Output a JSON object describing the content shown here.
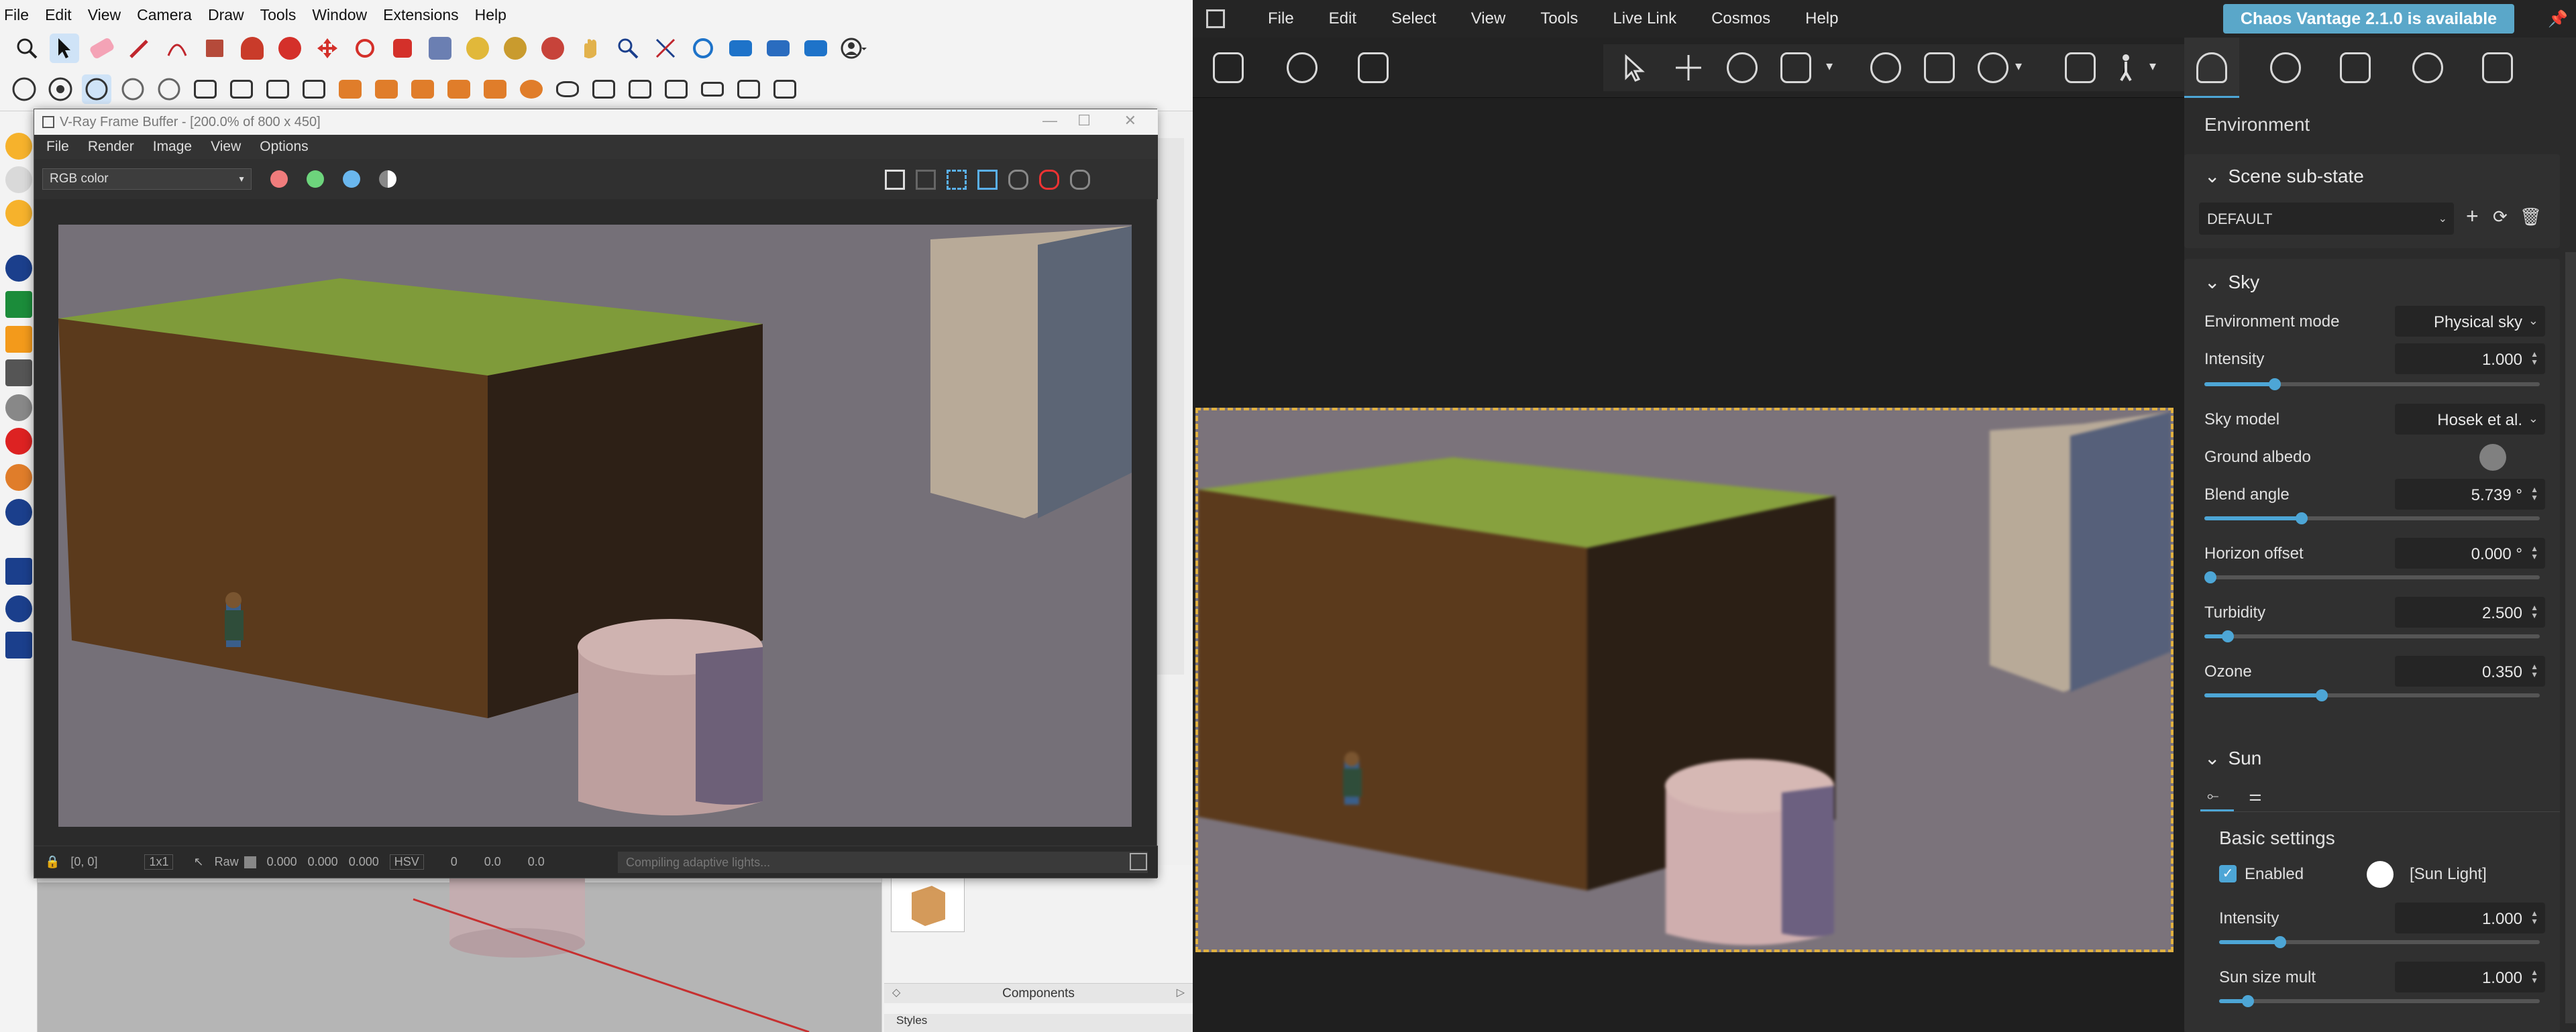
{
  "sketchup": {
    "menu": [
      "File",
      "Edit",
      "View",
      "Camera",
      "Draw",
      "Tools",
      "Window",
      "Extensions",
      "Help"
    ]
  },
  "vfb": {
    "title": "V-Ray Frame Buffer - [200.0% of 800 x 450]",
    "menu": [
      "File",
      "Render",
      "Image",
      "View",
      "Options"
    ],
    "channel": "RGB color",
    "status": {
      "coords": "[0, 0]",
      "zoom": "1x1",
      "raw_label": "Raw",
      "values": [
        "0.000",
        "0.000",
        "0.000"
      ],
      "color_mode": "HSV",
      "hsv_values": [
        "0",
        "0.0",
        "0.0"
      ],
      "progress_text": "Compiling adaptive lights..."
    }
  },
  "components_panel": {
    "title": "Components",
    "styles_label": "Styles"
  },
  "vantage": {
    "menu": [
      "File",
      "Edit",
      "Select",
      "View",
      "Tools",
      "Live Link",
      "Cosmos",
      "Help"
    ],
    "update_badge": "Chaos Vantage 2.1.0 is available",
    "panel_title": "Environment",
    "scene_substate": {
      "header": "Scene sub-state",
      "value": "DEFAULT"
    },
    "sky": {
      "header": "Sky",
      "environment_mode_label": "Environment mode",
      "environment_mode_value": "Physical sky",
      "intensity_label": "Intensity",
      "intensity_value": "1.000",
      "intensity_level": 0.21,
      "sky_model_label": "Sky model",
      "sky_model_value": "Hosek et al.",
      "ground_albedo_label": "Ground albedo",
      "blend_angle_label": "Blend angle",
      "blend_angle_value": "5.739 °",
      "blend_angle_level": 0.29,
      "horizon_offset_label": "Horizon offset",
      "horizon_offset_value": "0.000 °",
      "horizon_offset_level": 0.0,
      "turbidity_label": "Turbidity",
      "turbidity_value": "2.500",
      "turbidity_level": 0.07,
      "ozone_label": "Ozone",
      "ozone_value": "0.350",
      "ozone_level": 0.35
    },
    "sun": {
      "header": "Sun",
      "basic_settings": "Basic settings",
      "enabled_label": "Enabled",
      "enabled": true,
      "sun_light_label": "[Sun Light]",
      "intensity_label": "Intensity",
      "intensity_value": "1.000",
      "intensity_level": 0.19,
      "size_mult_label": "Sun size mult",
      "size_mult_value": "1.000",
      "size_mult_level": 0.09
    }
  }
}
